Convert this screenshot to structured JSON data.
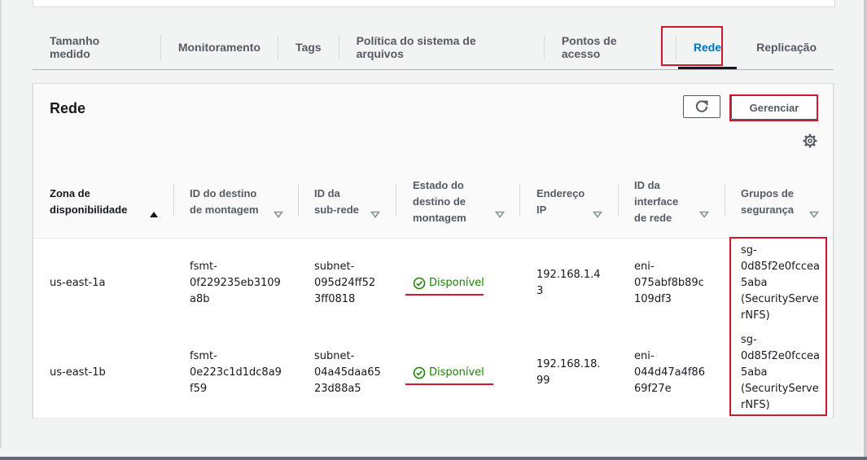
{
  "tabs": [
    {
      "label": "Tamanho medido",
      "active": false
    },
    {
      "label": "Monitoramento",
      "active": false
    },
    {
      "label": "Tags",
      "active": false
    },
    {
      "label": "Política do sistema de arquivos",
      "active": false
    },
    {
      "label": "Pontos de acesso",
      "active": false
    },
    {
      "label": "Rede",
      "active": true
    },
    {
      "label": "Replicação",
      "active": false
    }
  ],
  "panel": {
    "title": "Rede",
    "manage_label": "Gerenciar",
    "icons": {
      "refresh": "refresh-icon",
      "settings": "gear-icon"
    }
  },
  "table": {
    "columns": [
      "Zona de\ndisponibilidade",
      "ID do destino\nde montagem",
      "ID da\nsub-rede",
      "Estado do\ndestino de\nmontagem",
      "Endereço\nIP",
      "ID da\ninterface\nde rede",
      "Grupos de\nsegurança"
    ],
    "rows": [
      {
        "zone": "us-east-1a",
        "mount_target_id": "fsmt-\n0f229235eb3109\na8b",
        "subnet_id": "subnet-\n095d24ff52\n3ff0818",
        "state": "Disponível",
        "ip": "192.168.1.4\n3",
        "eni": "eni-\n075abf8b89c\n109df3",
        "security_groups": "sg-\n0d85f2e0fccea\n5aba\n(SecurityServe\nrNFS)"
      },
      {
        "zone": "us-east-1b",
        "mount_target_id": "fsmt-\n0e223c1d1dc8a9\nf59",
        "subnet_id": "subnet-\n04a45daa65\n23d88a5",
        "state": "Disponível",
        "ip": "192.168.18.\n99",
        "eni": "eni-\n044d47a4f86\n69f27e",
        "security_groups": "sg-\n0d85f2e0fccea\n5aba\n(SecurityServe\nrNFS)"
      }
    ]
  },
  "colors": {
    "accent": "#0073bb",
    "success": "#1d8102",
    "highlight": "#d1172b"
  }
}
